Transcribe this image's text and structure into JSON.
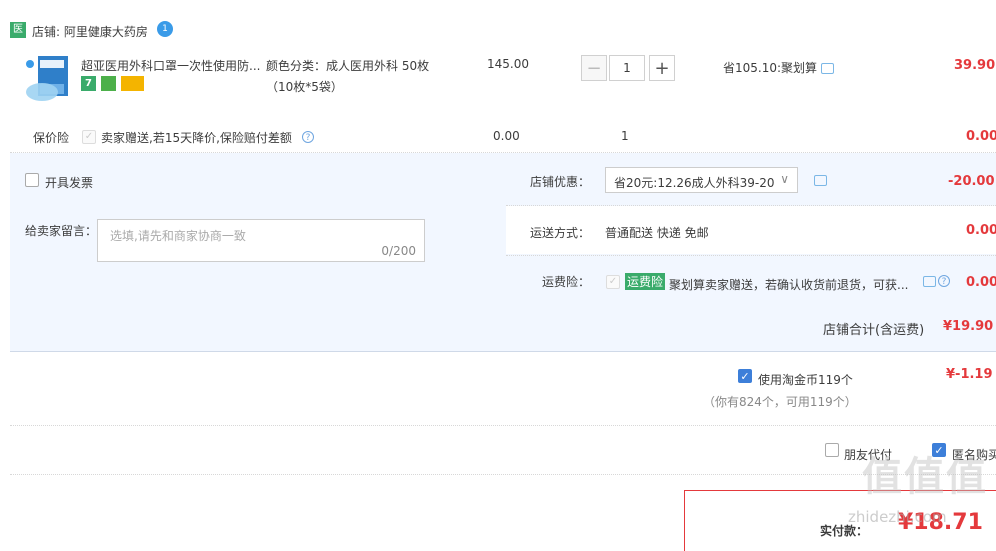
{
  "shop": {
    "badge": "医",
    "name": "店铺: 阿里健康大药房",
    "wangwang_badge": "1"
  },
  "item": {
    "title": "超亚医用外科口罩一次性使用防...",
    "sku_label": "颜色分类：成人医用外科 50枚",
    "sku_detail": "（10枚*5袋）",
    "unit_price": "145.00",
    "quantity": "1",
    "minus": "−",
    "plus": "+",
    "promo": "省105.10:聚划算",
    "subtotal": "39.90"
  },
  "insurance": {
    "label": "保价险",
    "desc": "卖家赠送,若15天降价,保险赔付差额",
    "price": "0.00",
    "qty": "1",
    "subtotal": "0.00"
  },
  "invoice": {
    "label": "开具发票"
  },
  "message": {
    "label": "给卖家留言：",
    "placeholder": "选填,请先和商家协商一致",
    "counter": "0/200"
  },
  "shop_discount": {
    "label": "店铺优惠：",
    "selected": "省20元:12.26成人外科39-20",
    "value": "-20.00"
  },
  "delivery": {
    "label": "运送方式：",
    "value": "普通配送 快递 免邮",
    "price": "0.00"
  },
  "shipping_insurance": {
    "label": "运费险：",
    "tag": "运费险",
    "desc": "聚划算卖家赠送，若确认收货前退货，可获...",
    "price": "0.00"
  },
  "shop_total": {
    "label": "店铺合计(含运费)",
    "value": "¥19.90"
  },
  "coins": {
    "label": "使用淘金币119个",
    "note": "（你有824个，可用119个）",
    "value": "¥-1.19"
  },
  "options": {
    "friend_pay": "朋友代付",
    "anonymous": "匿名购买"
  },
  "final": {
    "label": "实付款：",
    "value": "¥18.71"
  },
  "watermark": {
    "big": "值值值",
    "small": "zhidezhi.com"
  },
  "colors": {
    "accent": "#e4393c",
    "panel_bg": "#f2f7ff",
    "check_blue": "#3d7fd9",
    "green": "#3aab6b"
  }
}
